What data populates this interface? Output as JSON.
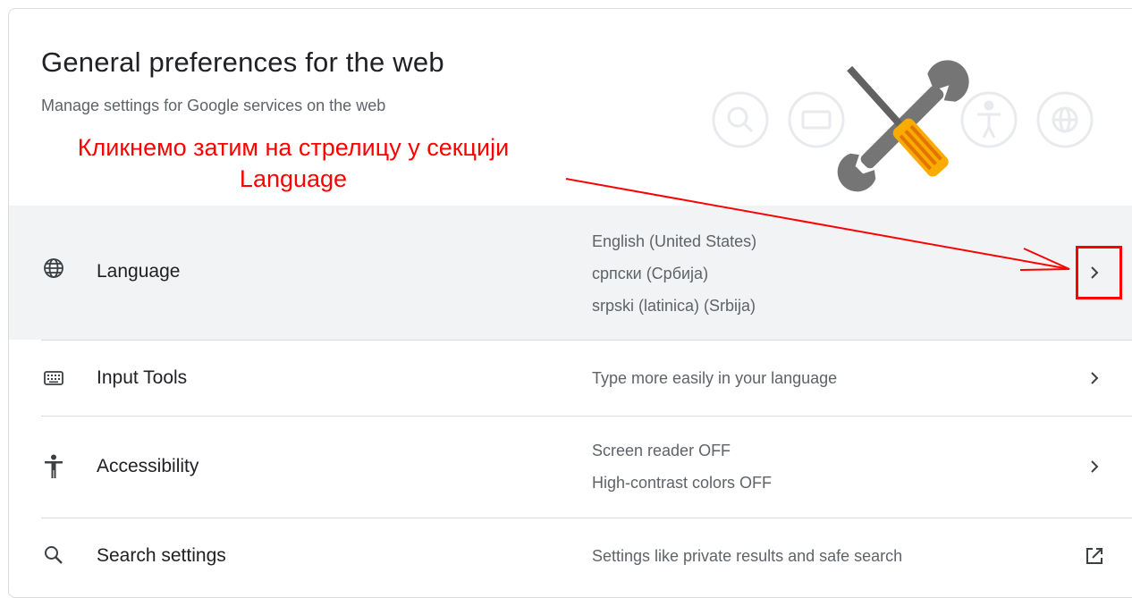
{
  "header": {
    "title": "General preferences for the web",
    "subtitle": "Manage settings for Google services on the web"
  },
  "annotation": {
    "line1": "Кликнемо затим на стрелицу у секцији",
    "line2": "Language",
    "color": "#ff0000"
  },
  "rows": [
    {
      "icon": "globe-icon",
      "label": "Language",
      "values": [
        "English (United States)",
        "српски (Србија)",
        "srpski (latinica) (Srbija)"
      ],
      "action_icon": "chevron-right-icon"
    },
    {
      "icon": "keyboard-icon",
      "label": "Input Tools",
      "values": [
        "Type more easily in your language"
      ],
      "action_icon": "chevron-right-icon"
    },
    {
      "icon": "accessibility-icon",
      "label": "Accessibility",
      "values": [
        "Screen reader OFF",
        "High-contrast colors OFF"
      ],
      "action_icon": "chevron-right-icon"
    },
    {
      "icon": "search-icon",
      "label": "Search settings",
      "values": [
        "Settings like private results and safe search"
      ],
      "action_icon": "open-in-new-icon"
    }
  ],
  "colors": {
    "selected_row_bg": "#f1f3f4",
    "divider": "#dadce0",
    "secondary_text": "#5f6368"
  }
}
